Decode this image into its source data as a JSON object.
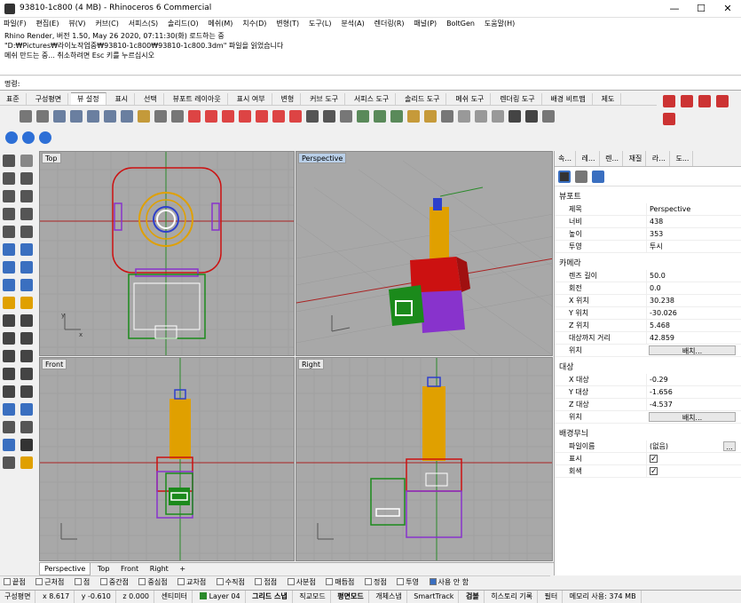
{
  "window": {
    "title": "93810-1c800 (4 MB) - Rhinoceros 6 Commercial",
    "minimize": "—",
    "maximize": "☐",
    "close": "✕"
  },
  "menu": [
    "파일(F)",
    "편집(E)",
    "뷰(V)",
    "커브(C)",
    "서피스(S)",
    "솔리드(O)",
    "메쉬(M)",
    "치수(D)",
    "변형(T)",
    "도구(L)",
    "분석(A)",
    "렌더링(R)",
    "패널(P)",
    "BoltGen",
    "도움말(H)"
  ],
  "history": [
    "Rhino Render, 버전 1.50, May 26 2020, 07:11:30(화) 로드하는 중",
    "\"D:₩Pictures₩라이노작업중₩93810-1c800₩93810-1c800.3dm\" 파일을 읽었습니다",
    "메쉬 만드는 중... 취소하려면 Esc 키를 누르십시오"
  ],
  "command": {
    "label": "명령:",
    "value": ""
  },
  "toolbar_tabs": [
    "표준",
    "구성평면",
    "뷰 설정",
    "표시",
    "선택",
    "뷰포트 레이아웃",
    "표시 여부",
    "변형",
    "커브 도구",
    "서피스 도구",
    "솔리드 도구",
    "메쉬 도구",
    "렌더링 도구",
    "배경 비트맵",
    "제도"
  ],
  "active_toolbar_tab": "뷰 설정",
  "viewports": {
    "top": "Top",
    "perspective": "Perspective",
    "front": "Front",
    "right": "Right"
  },
  "viewport_tabs": [
    "Perspective",
    "Top",
    "Front",
    "Right"
  ],
  "viewport_tab_add": "+",
  "panel": {
    "tabs": [
      "속...",
      "레...",
      "렌...",
      "재질",
      "라...",
      "도..."
    ],
    "sections": {
      "viewport": {
        "title": "뷰포트",
        "rows": [
          {
            "k": "제목",
            "v": "Perspective"
          },
          {
            "k": "너비",
            "v": "438"
          },
          {
            "k": "높이",
            "v": "353"
          },
          {
            "k": "투영",
            "v": "투시"
          }
        ]
      },
      "camera": {
        "title": "카메라",
        "rows": [
          {
            "k": "렌즈 길이",
            "v": "50.0"
          },
          {
            "k": "회전",
            "v": "0.0"
          },
          {
            "k": "X 위치",
            "v": "30.238"
          },
          {
            "k": "Y 위치",
            "v": "-30.026"
          },
          {
            "k": "Z 위치",
            "v": "5.468"
          },
          {
            "k": "대상까지 거리",
            "v": "42.859"
          }
        ],
        "position_label": "위치",
        "position_button": "배치..."
      },
      "target": {
        "title": "대상",
        "rows": [
          {
            "k": "X 대상",
            "v": "-0.29"
          },
          {
            "k": "Y 대상",
            "v": "-1.656"
          },
          {
            "k": "Z 대상",
            "v": "-4.537"
          }
        ],
        "position_label": "위치",
        "position_button": "배치..."
      },
      "wallpaper": {
        "title": "배경무늬",
        "file_label": "파일이름",
        "file_value": "(없음)",
        "browse": "...",
        "show_label": "표시",
        "gray_label": "회색"
      }
    }
  },
  "osnaps": [
    "끝점",
    "근처점",
    "점",
    "중간점",
    "중심점",
    "교차점",
    "수직점",
    "접점",
    "사분점",
    "매듭점",
    "정점",
    "투영"
  ],
  "osnap_disable": "사용 안 함",
  "status": {
    "cplane": "구성평면",
    "x": "x 8.617",
    "y": "y -0.610",
    "z": "z 0.000",
    "units": "센티미터",
    "layer": "Layer 04",
    "items": [
      "그리드 스냅",
      "직교모드",
      "평면모드",
      "개체스냅",
      "SmartTrack",
      "검볼",
      "히스토리 기록",
      "필터",
      "메모리 사용: 374 MB"
    ]
  },
  "colors": {
    "layer": "#2a8a2a",
    "perspective_tab": "#b9cfe8",
    "red": "#cc1111",
    "orange": "#e0a000",
    "green": "#1b8a1b",
    "purple": "#8833cc"
  }
}
